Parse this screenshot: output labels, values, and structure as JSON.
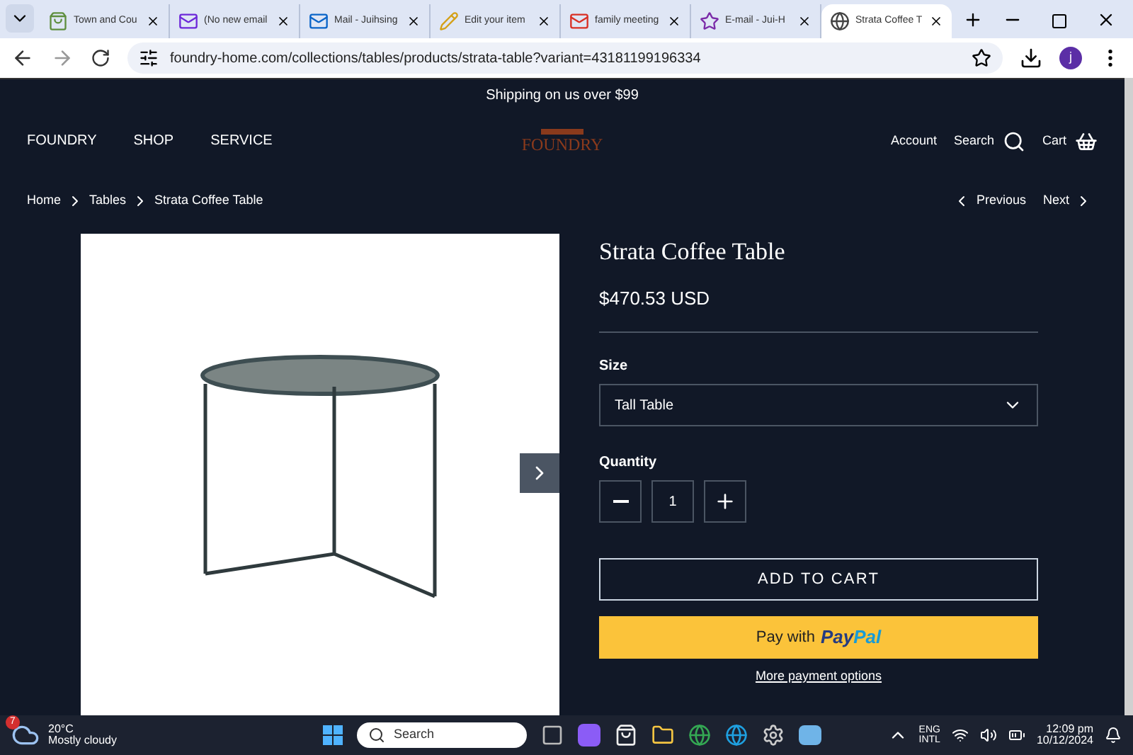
{
  "tabs": [
    {
      "title": "Town and Cou",
      "selected": false
    },
    {
      "title": "(No new email",
      "selected": false
    },
    {
      "title": "Mail - Juihsing",
      "selected": false
    },
    {
      "title": "Edit your item",
      "selected": false
    },
    {
      "title": "family meeting",
      "selected": false
    },
    {
      "title": "E-mail - Jui-H",
      "selected": false
    },
    {
      "title": "Strata Coffee T",
      "selected": true
    }
  ],
  "address_bar": {
    "url": "foundry-home.com/collections/tables/products/strata-table?variant=43181199196334",
    "profile": "j"
  },
  "announcement": "Shipping on us over $99",
  "nav": {
    "left": [
      "FOUNDRY",
      "SHOP",
      "SERVICE"
    ],
    "logo": "FOUNDRY",
    "account": "Account",
    "search": "Search",
    "cart": "Cart"
  },
  "breadcrumb": [
    "Home",
    "Tables",
    "Strata Coffee Table"
  ],
  "pager": {
    "previous": "Previous",
    "next": "Next"
  },
  "product": {
    "title": "Strata Coffee Table",
    "price": "$470.53 USD",
    "size_label": "Size",
    "size_value": "Tall Table",
    "quantity_label": "Quantity",
    "quantity": "1",
    "add_to_cart": "ADD TO CART",
    "paypal_prefix": "Pay with",
    "paypal_brand_a": "Pay",
    "paypal_brand_b": "Pal",
    "more_payment": "More payment options"
  },
  "taskbar": {
    "weather_badge": "7",
    "temperature": "20°C",
    "weather": "Mostly cloudy",
    "search": "Search",
    "lang_a": "ENG",
    "lang_b": "INTL",
    "time": "12:09 pm",
    "date": "10/12/2024"
  }
}
